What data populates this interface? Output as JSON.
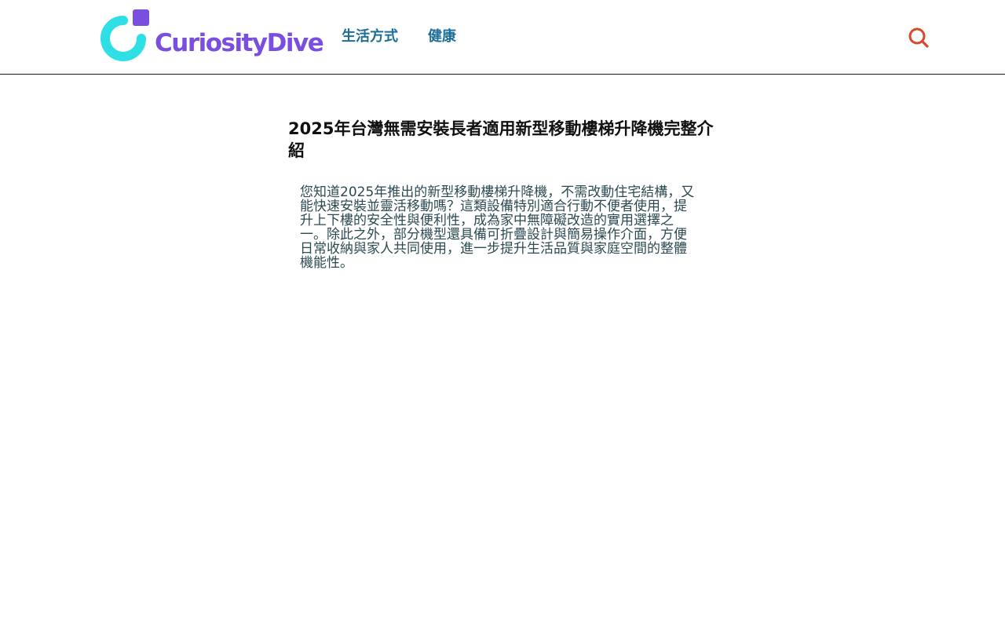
{
  "brand": {
    "name_prefix": "Curiosity",
    "name_suffix": "Dive",
    "colors": {
      "cyan": "#2ee0e6",
      "purple": "#7a4fe0",
      "nav": "#1e6f96",
      "search": "#d9482c"
    }
  },
  "nav": {
    "items": [
      {
        "label": "生活方式"
      },
      {
        "label": "健康"
      }
    ]
  },
  "search": {
    "icon": "search-icon"
  },
  "article": {
    "title": "2025年台灣無需安裝長者適用新型移動樓梯升降機完整介紹",
    "intro": "您知道2025年推出的新型移動樓梯升降機，不需改動住宅結構，又能快速安裝並靈活移動嗎？這類設備特別適合行動不便者使用，提升上下樓的安全性與便利性，成為家中無障礙改造的實用選擇之一。除此之外，部分機型還具備可折疊設計與簡易操作介面，方便日常收納與家人共同使用，進一步提升生活品質與家庭空間的整體機能性。"
  }
}
